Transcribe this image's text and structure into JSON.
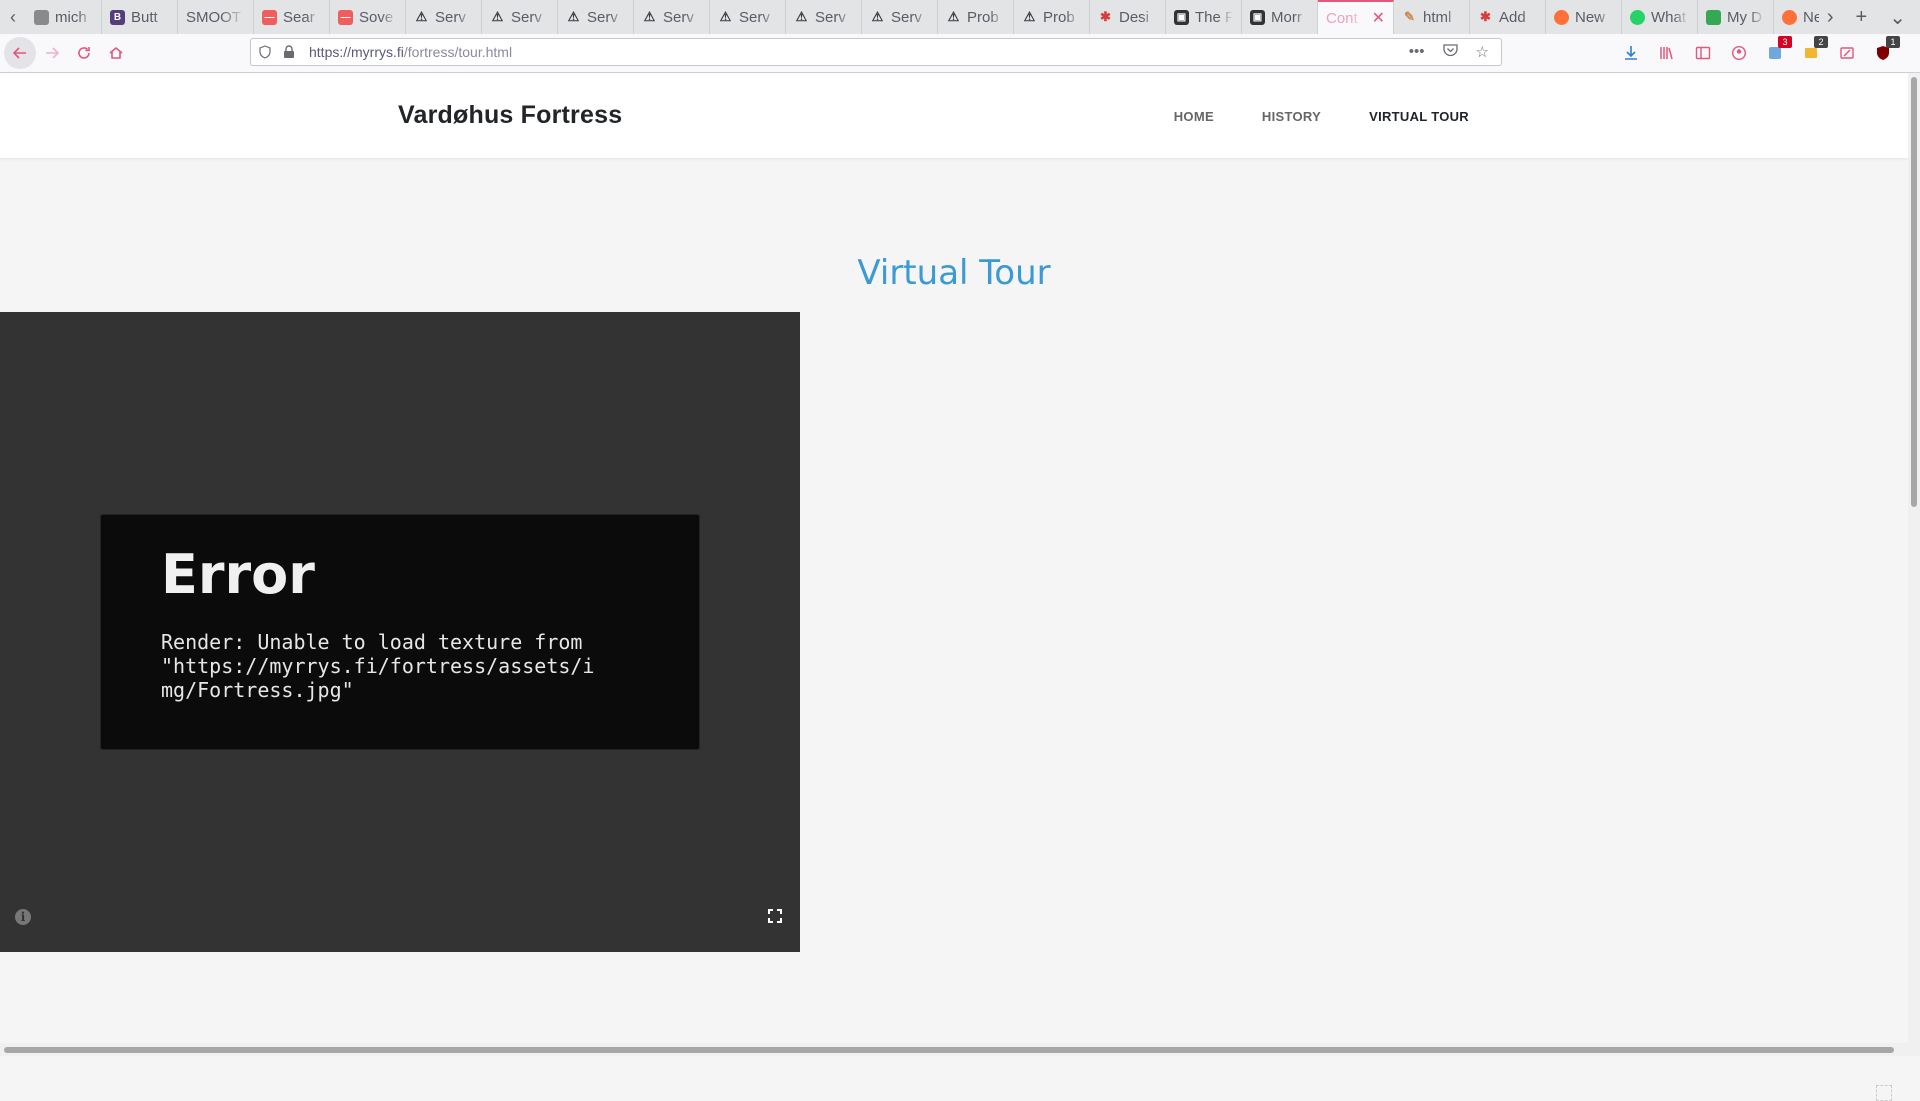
{
  "browser": {
    "tabs": [
      {
        "title": "mich",
        "favicon": "generic"
      },
      {
        "title": "Butt",
        "favicon": "bootstrap"
      },
      {
        "title": "SMOOT",
        "favicon": "none"
      },
      {
        "title": "Sear",
        "favicon": "red-site"
      },
      {
        "title": "Sove",
        "favicon": "red-site"
      },
      {
        "title": "Serv",
        "favicon": "warning"
      },
      {
        "title": "Serv",
        "favicon": "warning"
      },
      {
        "title": "Serv",
        "favicon": "warning"
      },
      {
        "title": "Serv",
        "favicon": "warning"
      },
      {
        "title": "Serv",
        "favicon": "warning"
      },
      {
        "title": "Serv",
        "favicon": "warning"
      },
      {
        "title": "Serv",
        "favicon": "warning"
      },
      {
        "title": "Prob",
        "favicon": "warning"
      },
      {
        "title": "Prob",
        "favicon": "warning"
      },
      {
        "title": "Desi",
        "favicon": "red-bug"
      },
      {
        "title": "The F",
        "favicon": "robot"
      },
      {
        "title": "Morr",
        "favicon": "robot"
      },
      {
        "title": "Cont",
        "favicon": "none",
        "active": true
      },
      {
        "title": "html",
        "favicon": "pen"
      },
      {
        "title": "Add",
        "favicon": "red-bug"
      },
      {
        "title": "New",
        "favicon": "firefox"
      },
      {
        "title": "What",
        "favicon": "whatsapp"
      },
      {
        "title": "My D",
        "favicon": "drive"
      },
      {
        "title": "New",
        "favicon": "firefox"
      }
    ],
    "url_host": "https://myrrys.fi",
    "url_path": "/fortress/tour.html",
    "badges": {
      "ext1": "3",
      "ext2": "2",
      "ext3": "1"
    },
    "accent_color": "#e2577a"
  },
  "site": {
    "brand": "Vardøhus Fortress",
    "nav": [
      {
        "label": "HOME"
      },
      {
        "label": "HISTORY"
      },
      {
        "label": "VIRTUAL TOUR",
        "current": true
      }
    ],
    "page_title": "Virtual Tour",
    "title_color": "#3b9ad4"
  },
  "viewer": {
    "error_title": "Error",
    "error_message": "Render: Unable to load texture from \"https://myrrys.fi/fortress/assets/img/Fortress.jpg\"",
    "info_icon": "info-icon",
    "fullscreen_icon": "fullscreen-icon"
  }
}
